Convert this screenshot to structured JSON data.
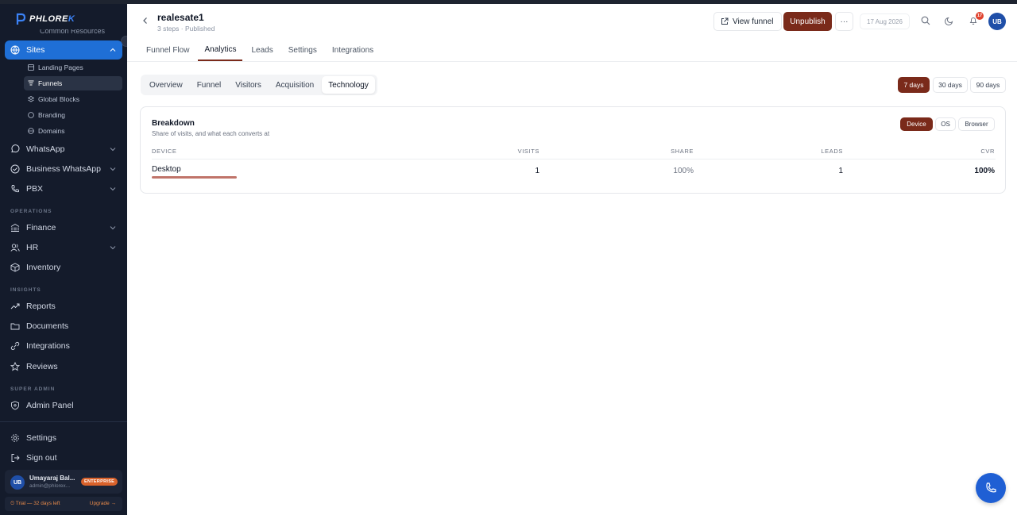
{
  "brand": {
    "logo_text": "PHLORE",
    "logo_accent": "K"
  },
  "sidebar": {
    "clipped_item": "Common Resources",
    "main_items": [
      {
        "label": "Sites",
        "icon": "globe-icon",
        "active": true
      },
      {
        "label": "WhatsApp",
        "icon": "chat-icon"
      },
      {
        "label": "Business WhatsApp",
        "icon": "check-circle-icon"
      },
      {
        "label": "PBX",
        "icon": "phone-icon"
      }
    ],
    "sites_children": [
      {
        "label": "Landing Pages",
        "icon": "layout-icon"
      },
      {
        "label": "Funnels",
        "icon": "funnel-icon",
        "active": true
      },
      {
        "label": "Global Blocks",
        "icon": "blocks-icon"
      },
      {
        "label": "Branding",
        "icon": "palette-icon"
      },
      {
        "label": "Domains",
        "icon": "globe-icon"
      }
    ],
    "operations_label": "OPERATIONS",
    "operations": [
      {
        "label": "Finance",
        "icon": "bank-icon"
      },
      {
        "label": "HR",
        "icon": "users-icon"
      },
      {
        "label": "Inventory",
        "icon": "box-icon"
      }
    ],
    "insights_label": "INSIGHTS",
    "insights": [
      {
        "label": "Reports",
        "icon": "trend-icon"
      },
      {
        "label": "Documents",
        "icon": "folder-icon"
      },
      {
        "label": "Integrations",
        "icon": "plug-icon"
      },
      {
        "label": "Reviews",
        "icon": "star-icon"
      }
    ],
    "super_admin_label": "SUPER ADMIN",
    "admin_panel": "Admin Panel",
    "settings": "Settings",
    "sign_out": "Sign out",
    "user": {
      "initials": "UB",
      "name": "Umayaraj Bal...",
      "email": "admin@phlorex...",
      "badge": "ENTERPRISE"
    },
    "trial": {
      "text": "⏲ Trial — 32 days left",
      "upgrade": "Upgrade →"
    }
  },
  "header": {
    "title": "realesate1",
    "meta": "3 steps · Published",
    "view_funnel": "View funnel",
    "unpublish": "Unpublish",
    "more": "···",
    "date": "17 Aug 2026",
    "notifications": "17",
    "avatar": "UB"
  },
  "tabs": [
    "Funnel Flow",
    "Analytics",
    "Leads",
    "Settings",
    "Integrations"
  ],
  "active_tab": "Analytics",
  "subtabs": [
    "Overview",
    "Funnel",
    "Visitors",
    "Acquisition",
    "Technology"
  ],
  "active_subtab": "Technology",
  "ranges": [
    "7 days",
    "30 days",
    "90 days"
  ],
  "active_range": "7 days",
  "breakdown": {
    "title": "Breakdown",
    "subtitle": "Share of visits, and what each converts at",
    "dimensions": [
      "Device",
      "OS",
      "Browser"
    ],
    "active_dimension": "Device",
    "columns": [
      "DEVICE",
      "VISITS",
      "SHARE",
      "LEADS",
      "CVR"
    ],
    "rows": [
      {
        "device": "Desktop",
        "visits": "1",
        "share": "100%",
        "leads": "1",
        "cvr": "100%",
        "share_fraction": 1.0
      }
    ]
  },
  "colors": {
    "accent": "#7a2a1a",
    "sidebar_bg": "#141b2b",
    "active_nav": "#1f6fd6",
    "fab": "#1f5fd4"
  }
}
